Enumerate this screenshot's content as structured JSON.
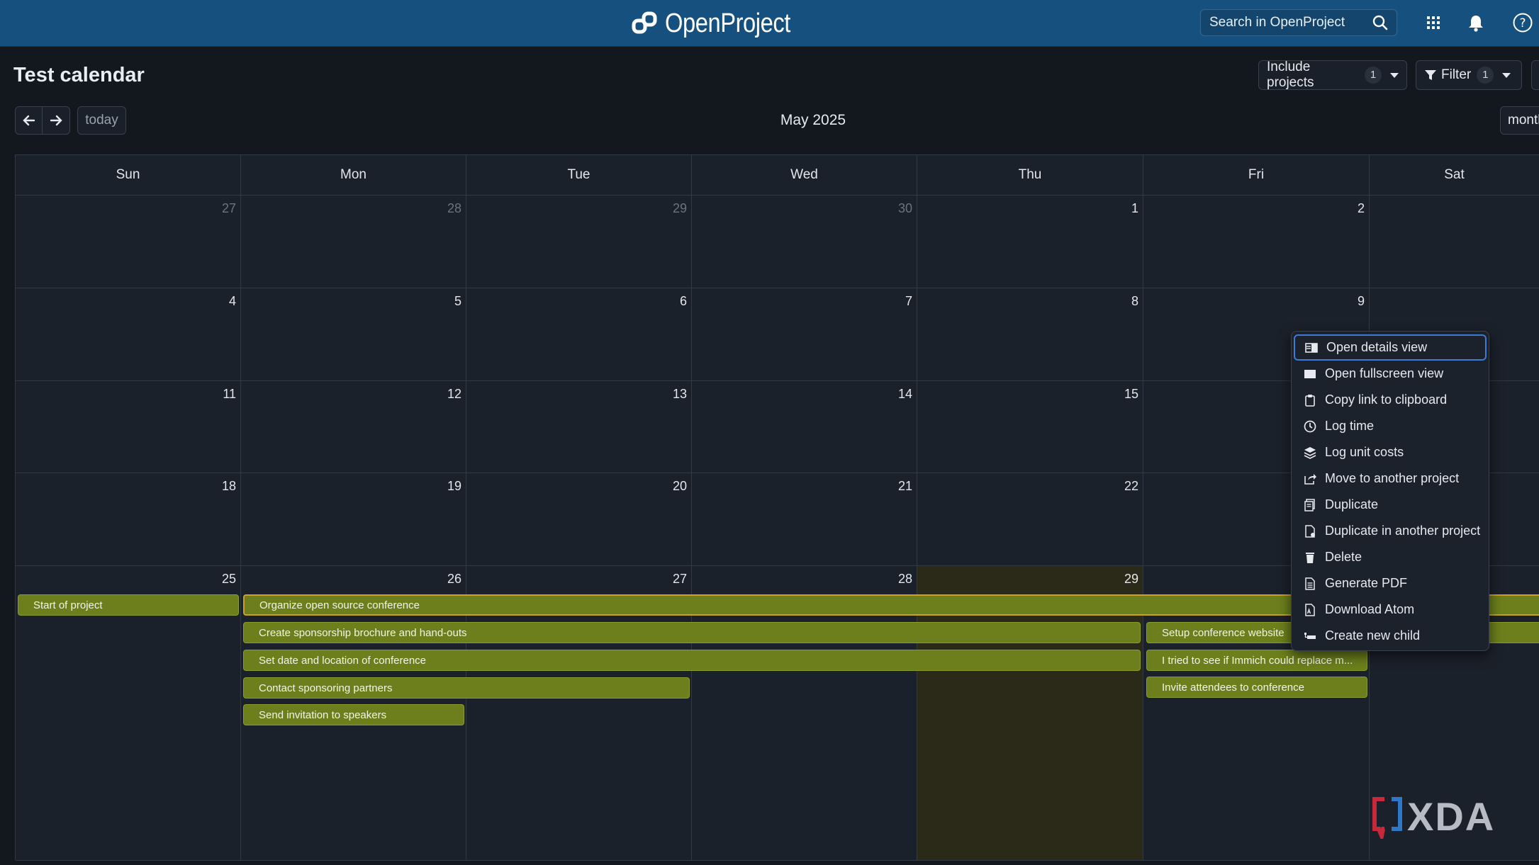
{
  "header": {
    "brand": "OpenProject",
    "search_placeholder": "Search in OpenProject",
    "icons": [
      "search-icon",
      "apps-grid-icon",
      "bell-icon",
      "help-icon"
    ]
  },
  "toolbar": {
    "title": "Test calendar",
    "include_projects_label": "Include projects",
    "include_projects_count": "1",
    "filter_label": "Filter",
    "filter_count": "1",
    "today_label": "today",
    "month_label": "May 2025",
    "view_label": "month"
  },
  "calendar": {
    "weekdays": [
      "Sun",
      "Mon",
      "Tue",
      "Wed",
      "Thu",
      "Fri",
      "Sat"
    ],
    "weeks": [
      [
        "27",
        "28",
        "29",
        "30",
        "1",
        "2",
        ""
      ],
      [
        "4",
        "5",
        "6",
        "7",
        "8",
        "9",
        ""
      ],
      [
        "11",
        "12",
        "13",
        "14",
        "15",
        "",
        ""
      ],
      [
        "18",
        "19",
        "20",
        "21",
        "22",
        "",
        ""
      ],
      [
        "25",
        "26",
        "27",
        "28",
        "29",
        "",
        ""
      ]
    ],
    "events": {
      "start_of_project": "Start of project",
      "organize_conference": "Organize open source conference",
      "sponsorship_brochure": "Create sponsorship brochure and hand-outs",
      "setup_website": "Setup conference website",
      "set_date_location": "Set date and location of conference",
      "immich": "I tried to see if Immich could replace m...",
      "contact_sponsors": "Contact sponsoring partners",
      "invite_attendees": "Invite attendees to conference",
      "send_invitation": "Send invitation to speakers"
    }
  },
  "context_menu": {
    "items": [
      {
        "label": "Open details view",
        "icon": "details-view-icon"
      },
      {
        "label": "Open fullscreen view",
        "icon": "fullscreen-icon"
      },
      {
        "label": "Copy link to clipboard",
        "icon": "clipboard-icon"
      },
      {
        "label": "Log time",
        "icon": "clock-icon"
      },
      {
        "label": "Log unit costs",
        "icon": "stack-icon"
      },
      {
        "label": "Move to another project",
        "icon": "move-icon"
      },
      {
        "label": "Duplicate",
        "icon": "duplicate-icon"
      },
      {
        "label": "Duplicate in another project",
        "icon": "duplicate-file-icon"
      },
      {
        "label": "Delete",
        "icon": "trash-icon"
      },
      {
        "label": "Generate PDF",
        "icon": "pdf-icon"
      },
      {
        "label": "Download Atom",
        "icon": "atom-file-icon"
      },
      {
        "label": "Create new child",
        "icon": "child-icon"
      }
    ]
  },
  "watermark": "XDA",
  "colors": {
    "header": "#16507e",
    "background": "#13181f",
    "event": "#6c7f1c",
    "today": "#2b2a18",
    "focus": "#3d7bd6"
  }
}
